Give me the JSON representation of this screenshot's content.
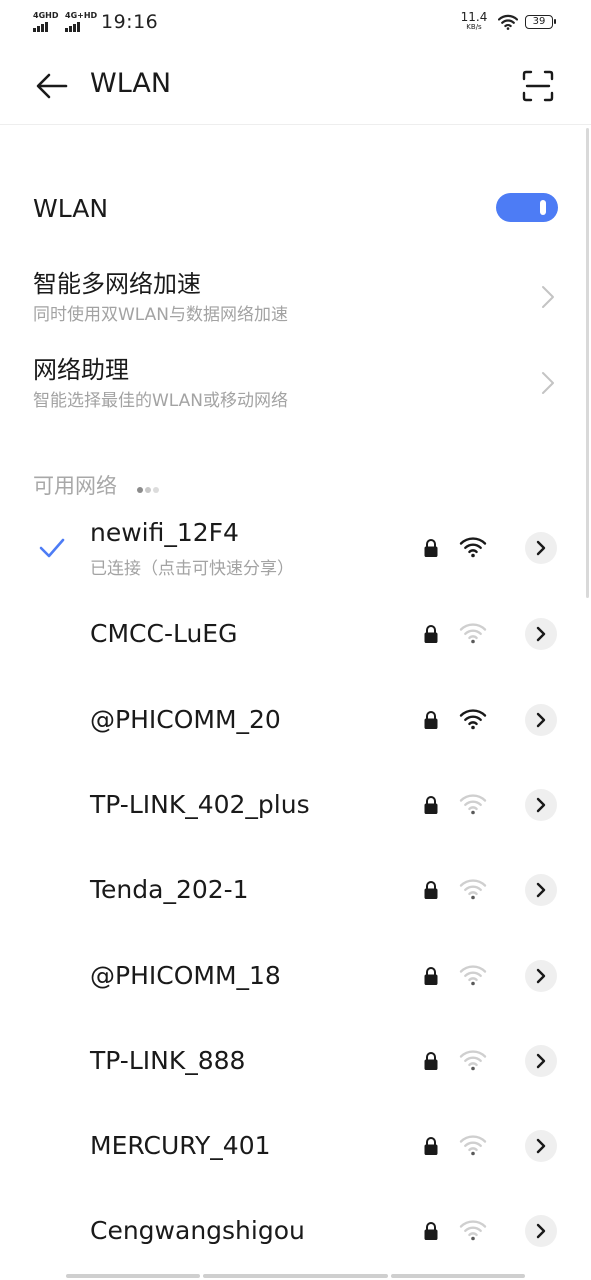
{
  "status_bar": {
    "signal1": "4GHD",
    "signal2": "4G+HD",
    "time": "19:16",
    "speed_value": "11.4",
    "speed_unit": "KB/s",
    "battery": "39"
  },
  "header": {
    "title": "WLAN",
    "back_icon": "back-arrow-icon",
    "scan_icon": "scan-icon"
  },
  "wlan_toggle": {
    "label": "WLAN",
    "on": true,
    "accent_color": "#4d7cf5"
  },
  "settings": [
    {
      "title": "智能多网络加速",
      "subtitle": "同时使用双WLAN与数据网络加速"
    },
    {
      "title": "网络助理",
      "subtitle": "智能选择最佳的WLAN或移动网络"
    }
  ],
  "section": {
    "available_label": "可用网络"
  },
  "networks": [
    {
      "name": "newifi_12F4",
      "status": "已连接（点击可快速分享）",
      "connected": true,
      "locked": true,
      "signal": "strong"
    },
    {
      "name": "CMCC-LuEG",
      "status": "",
      "connected": false,
      "locked": true,
      "signal": "weak"
    },
    {
      "name": "@PHICOMM_20",
      "status": "",
      "connected": false,
      "locked": true,
      "signal": "strong"
    },
    {
      "name": "TP-LINK_402_plus",
      "status": "",
      "connected": false,
      "locked": true,
      "signal": "weak"
    },
    {
      "name": "Tenda_202-1",
      "status": "",
      "connected": false,
      "locked": true,
      "signal": "weak"
    },
    {
      "name": "@PHICOMM_18",
      "status": "",
      "connected": false,
      "locked": true,
      "signal": "weak"
    },
    {
      "name": "TP-LINK_888",
      "status": "",
      "connected": false,
      "locked": true,
      "signal": "weak"
    },
    {
      "name": "MERCURY_401",
      "status": "",
      "connected": false,
      "locked": true,
      "signal": "weak"
    },
    {
      "name": "Cengwangshigou",
      "status": "",
      "connected": false,
      "locked": true,
      "signal": "weak"
    }
  ]
}
